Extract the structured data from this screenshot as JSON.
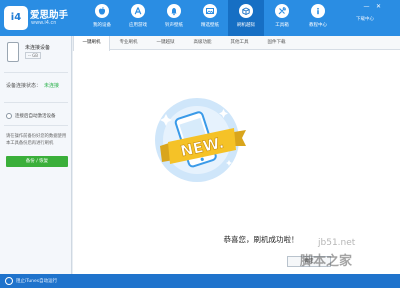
{
  "brand": {
    "logo_text": "i4",
    "name": "爱思助手",
    "url": "www.i4.cn"
  },
  "nav": {
    "items": [
      {
        "label": "我的设备",
        "icon": "apple-icon"
      },
      {
        "label": "应用游戏",
        "icon": "app-store-icon"
      },
      {
        "label": "铃声壁纸",
        "icon": "bell-icon"
      },
      {
        "label": "精选壁纸",
        "icon": "wallpaper-icon"
      },
      {
        "label": "刷机越狱",
        "icon": "box-icon"
      },
      {
        "label": "工具箱",
        "icon": "tools-icon"
      },
      {
        "label": "教程中心",
        "icon": "info-icon"
      }
    ],
    "active_index": 4
  },
  "window": {
    "download_center": "下载中心",
    "minimize": "—",
    "close": "✕"
  },
  "sidebar": {
    "device_name": "未连接设备",
    "device_badge": "-- GB",
    "connection_label": "设备连接状态：",
    "connection_value": "未连接",
    "radio_label": "连接后自动激活设备",
    "hint": "请在操作前备份好您的数据使用本工具备份后再进行刷机",
    "backup_button": "备份 / 恢复"
  },
  "tabs": [
    "一键刷机",
    "专业刷机",
    "一键越狱",
    "高级功能",
    "其他工具",
    "固件下载"
  ],
  "main": {
    "badge_text": "NEW.",
    "success_message": "恭喜您，刷机成功啦！",
    "ok_button": "确定"
  },
  "bottom": {
    "text": "阻止iTunes自动运行"
  },
  "watermark": {
    "url": "jb51.net",
    "text": "脚本之家"
  },
  "colors": {
    "primary": "#2a8de3",
    "active_nav": "#166fc4",
    "success": "#2bb24c",
    "badge_yellow": "#f5c227"
  }
}
